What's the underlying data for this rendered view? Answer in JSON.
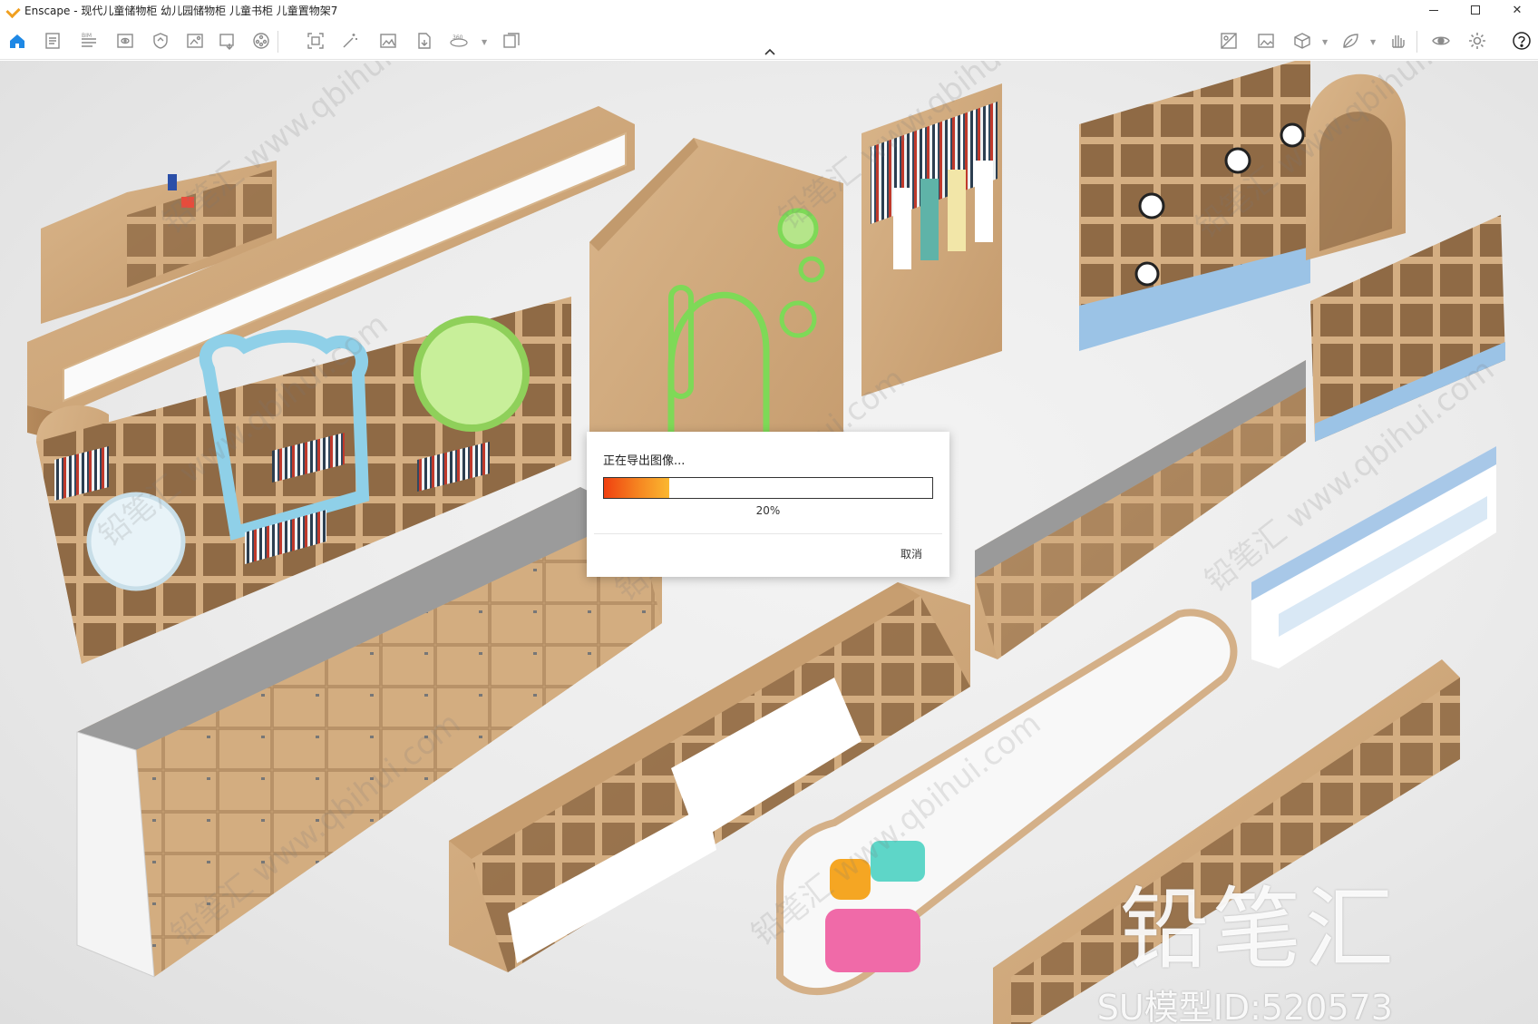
{
  "window": {
    "title": "Enscape - 现代儿童储物柜 幼儿园储物柜 儿童书柜 儿童置物架7",
    "minimize_label": "",
    "maximize_label": "",
    "close_label": "✕"
  },
  "toolbar": {
    "left_icons": [
      "home-icon",
      "document-icon",
      "bim-icon",
      "preview-window-icon",
      "shield-icon",
      "image-export-icon",
      "image-export-alt-icon",
      "video-icon",
      "screenshot-icon",
      "magic-wand-icon",
      "image-icon",
      "file-export-icon",
      "panorama-360-icon",
      "batch-export-icon"
    ],
    "right_icons": [
      "asset-library-icon",
      "gallery-icon",
      "cube-icon",
      "leaf-icon",
      "hand-icon",
      "eye-icon",
      "settings-icon",
      "help-icon"
    ]
  },
  "dialog": {
    "title": "正在导出图像...",
    "progress_percent": 20,
    "progress_label": "20%",
    "cancel_label": "取消"
  },
  "watermark": {
    "brand": "铅笔汇",
    "model_id": "SU模型ID:520573",
    "tile_text": "铅笔汇 www.qbihui.com"
  },
  "colors": {
    "accent_orange": "#f58220",
    "toolbar_icon_gray": "#8a8a8a",
    "home_icon_blue": "#1e88e5"
  }
}
